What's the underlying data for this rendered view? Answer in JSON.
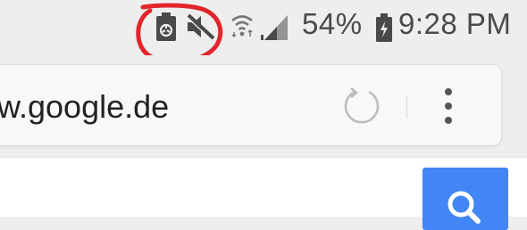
{
  "status_bar": {
    "icons": [
      "battery-saver-icon",
      "vibrate-off-icon",
      "wifi-icon",
      "cellular-signal-icon",
      "battery-charging-icon"
    ],
    "battery_percent": "54%",
    "time": "9:28 PM"
  },
  "address_bar": {
    "url": "w.google.de",
    "reload_icon": "reload-icon",
    "menu_icon": "more-vert-icon"
  },
  "page": {
    "search_icon": "search-icon"
  },
  "colors": {
    "annotation": "#e0262b",
    "search_button": "#4285f4",
    "status_icons": "#4a4a4a"
  }
}
